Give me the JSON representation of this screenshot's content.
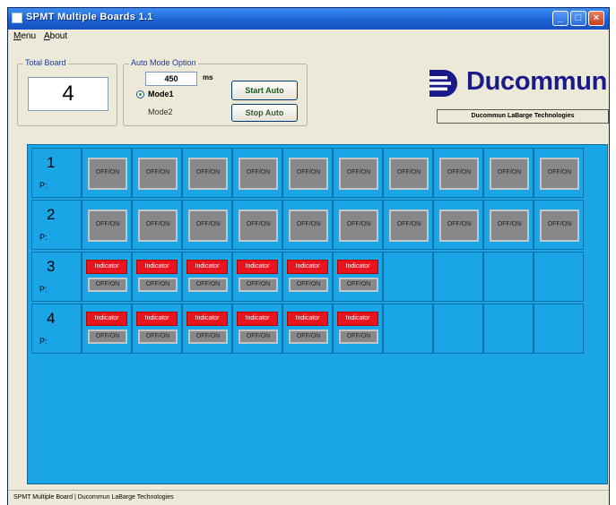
{
  "window": {
    "title": "SPMT Multiple Boards 1.1",
    "min_glyph": "_",
    "max_glyph": "□",
    "close_glyph": "×"
  },
  "menu": {
    "items": [
      {
        "accel": "M",
        "rest": "enu"
      },
      {
        "accel": "A",
        "rest": "bout"
      }
    ]
  },
  "total_board": {
    "label": "Total Board",
    "value": "4"
  },
  "auto_mode": {
    "label": "Auto Mode Option",
    "interval_value": "450",
    "interval_unit": "ms",
    "mode1_label": "Mode1",
    "mode2_label": "Mode2",
    "selected_mode": "Mode1",
    "start_button": "Start Auto",
    "stop_button": "Stop Auto"
  },
  "brand": {
    "logo_text": "Ducommun",
    "logo_color": "#1a1a8a",
    "company_name": "Ducommun LaBarge Technologies"
  },
  "boards": [
    {
      "number": "1",
      "port_label": "P:",
      "type": "switch",
      "switch_label": "OFF/ON",
      "count": 10
    },
    {
      "number": "2",
      "port_label": "P:",
      "type": "switch",
      "switch_label": "OFF/ON",
      "count": 10
    },
    {
      "number": "3",
      "port_label": "P:",
      "type": "indicator",
      "indicator_label": "Indicator",
      "switch_label": "OFF/ON",
      "count": 6
    },
    {
      "number": "4",
      "port_label": "P:",
      "type": "indicator",
      "indicator_label": "Indicator",
      "switch_label": "OFF/ON",
      "count": 6
    }
  ],
  "colors": {
    "panel": "#1aa6e6",
    "indicator": "#e8151f",
    "switch": "#888888"
  },
  "statusbar": {
    "text": "SPMT Multiple Board | Ducommun LaBarge Technologies"
  }
}
